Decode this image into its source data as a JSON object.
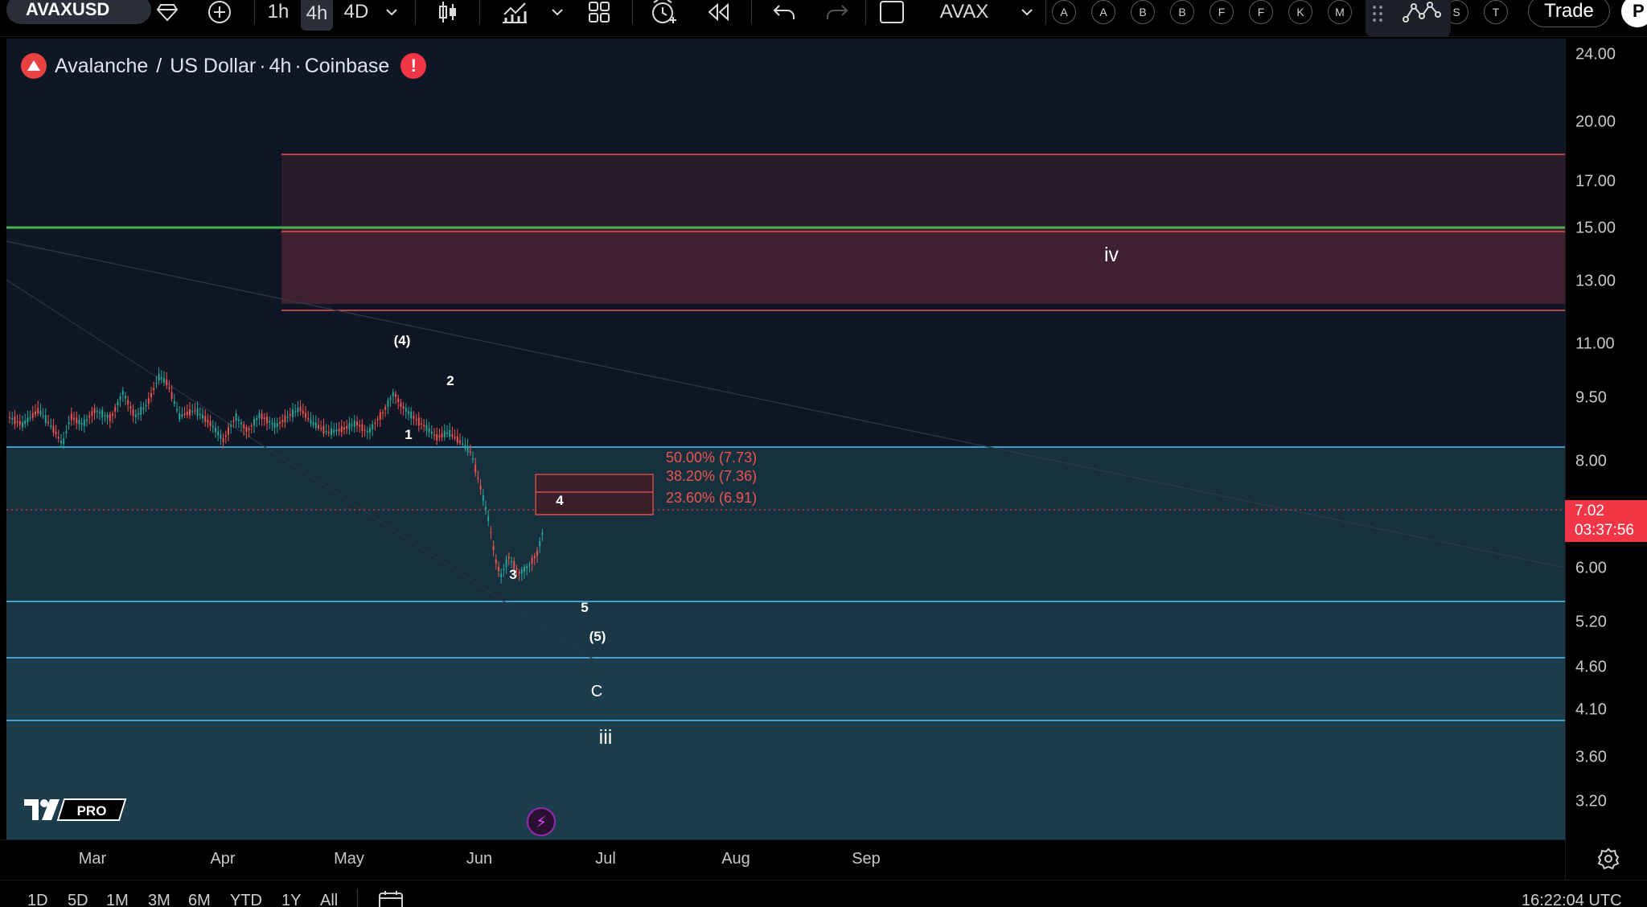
{
  "toolbar": {
    "symbol": "AVAXUSD",
    "timeframes": [
      "1h",
      "4h",
      "4D"
    ],
    "active_timeframe": "4h",
    "compare_symbol": "AVAX",
    "letter_buttons": [
      "A",
      "A",
      "B",
      "B",
      "F",
      "F",
      "K",
      "M",
      "S",
      "T"
    ],
    "trade_label": "Trade",
    "corner_letter": "P"
  },
  "chart": {
    "title_parts": [
      "Avalanche",
      "/",
      "US Dollar",
      "·",
      "4h",
      "·",
      "Coinbase"
    ],
    "warning_mark": "!",
    "price_axis_ticks": [
      "24.00",
      "20.00",
      "17.00",
      "15.00",
      "13.00",
      "11.00",
      "9.50",
      "8.00",
      "6.00",
      "5.20",
      "4.60",
      "4.10",
      "3.60",
      "3.20"
    ],
    "time_axis_ticks": [
      "Mar",
      "Apr",
      "May",
      "Jun",
      "Jul",
      "Aug",
      "Sep"
    ],
    "current_price": "7.02",
    "countdown": "03:37:56",
    "wave_labels": [
      "(4)",
      "2",
      "1",
      "3",
      "4",
      "5",
      "(5)",
      "C",
      "iii",
      "iv"
    ],
    "fib_labels": [
      "50.00% (7.73)",
      "38.20% (7.36)",
      "23.60% (6.91)"
    ],
    "colors": {
      "background": "#0f1624",
      "support_zone": "#1a3a48",
      "resistance_zone": "#4a2233",
      "cyan_line": "#4fc3f7",
      "red_line": "#ef5350",
      "green_line": "#4caf50",
      "price_tag": "#f23645"
    }
  },
  "logo": {
    "pro_label": "PRO"
  },
  "bottom_bar": {
    "ranges": [
      "1D",
      "5D",
      "1M",
      "3M",
      "6M",
      "YTD",
      "1Y",
      "All"
    ],
    "clock": "16:22:04 UTC"
  }
}
